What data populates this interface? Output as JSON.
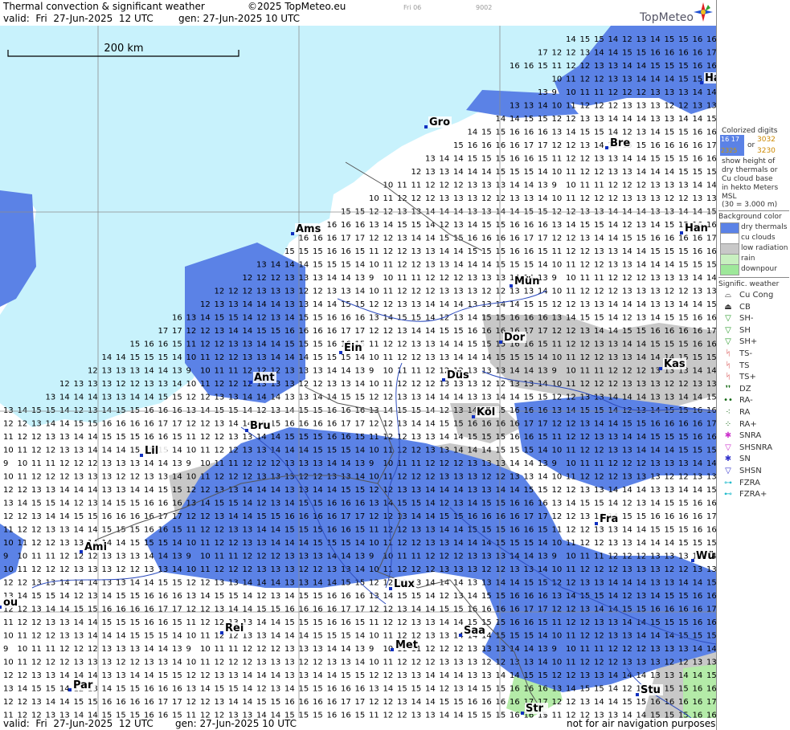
{
  "header": {
    "title": "Thermal convection & significant weather",
    "copyright": "©2025 TopMeteo.eu",
    "valid": "valid:  Fri  27-Jun-2025  12 UTC",
    "gen": "gen: 27-Jun-2025 10 UTC",
    "run_small": "Fri 06",
    "code_small": "9002",
    "brand": "TopMeteo"
  },
  "map": {
    "scale_label": "200 km",
    "colors": {
      "sea": "#c8f2fc",
      "dry": "#5b82e6",
      "cu": "#ffffff",
      "low": "#c8c8c8",
      "rain": "#b4eba8",
      "river": "#2c4bbd",
      "border": "#555555",
      "grid": "#8c8c8c"
    },
    "cities": [
      {
        "name": "Gro"
      },
      {
        "name": "Bre"
      },
      {
        "name": "Ha"
      },
      {
        "name": "Ams"
      },
      {
        "name": "Han"
      },
      {
        "name": "Mün"
      },
      {
        "name": "Dor"
      },
      {
        "name": "Ein"
      },
      {
        "name": "Ant"
      },
      {
        "name": "Düs"
      },
      {
        "name": "Kas"
      },
      {
        "name": "Bru"
      },
      {
        "name": "Köl"
      },
      {
        "name": "Lil"
      },
      {
        "name": "Fra"
      },
      {
        "name": "Ami"
      },
      {
        "name": "Wü"
      },
      {
        "name": "Lux"
      },
      {
        "name": "Rei"
      },
      {
        "name": "Saa"
      },
      {
        "name": "Met"
      },
      {
        "name": "Par"
      },
      {
        "name": "Stu"
      },
      {
        "name": "Str"
      },
      {
        "name": "ou"
      }
    ],
    "number_rows": [
      "13 14 15 15 14 12 13 14 15 15 16 16 16",
      "12 12 13 14 14 15 15 16 16 16 16 17 17",
      "11 12 12 13 13 14 14 15 15 15 16 16 15",
      "10 11 12 12 13 13 14 14 14 15 15 15 14",
      "9 10 11 11 12 12 12 13 13 13 14 14 13",
      "10 11 12 12 12 13 13 13 12 12 13 13 14",
      "12 12 13 13 14 14 14 13 13 14 14 15 15"
    ]
  },
  "footer": {
    "valid": "valid:  Fri  27-Jun-2025  12 UTC",
    "gen": "gen: 27-Jun-2025 10 UTC",
    "disclaimer": "not for air navigation purposes"
  },
  "legend": {
    "digits_title": [
      "Colorized digits"
    ],
    "digit_examples": {
      "a": "16 17",
      "b": "3032",
      "or": "or",
      "c": "2325",
      "d": "3230"
    },
    "digits_desc": [
      "show height of",
      "dry thermals or",
      "Cu cloud base",
      "in hekto Meters",
      "MSL",
      "(30 = 3.000 m)"
    ],
    "bg_title": "Background color",
    "bg_items": [
      {
        "label": "dry thermals",
        "color": "#5b82e6"
      },
      {
        "label": "cu clouds",
        "color": "#ffffff"
      },
      {
        "label": "low radiation",
        "color": "#c8c8c8"
      },
      {
        "label": "rain",
        "color": "#c8f0c0"
      },
      {
        "label": "downpour",
        "color": "#9ee89a"
      }
    ],
    "wx_title": "Signific. weather",
    "wx_items": [
      {
        "label": "Cu Cong",
        "icon": "cu-cong-icon",
        "glyph": "⌓",
        "color": "#333333"
      },
      {
        "label": "CB",
        "icon": "cb-icon",
        "glyph": "⏏",
        "color": "#333333"
      },
      {
        "label": "SH-",
        "icon": "shower-light-icon",
        "glyph": "▽",
        "color": "#2a9a2a"
      },
      {
        "label": "SH",
        "icon": "shower-icon",
        "glyph": "▽",
        "color": "#2a9a2a"
      },
      {
        "label": "SH+",
        "icon": "shower-heavy-icon",
        "glyph": "▽",
        "color": "#2a9a2a"
      },
      {
        "label": "TS-",
        "icon": "thunderstorm-light-icon",
        "glyph": "ᛋ",
        "color": "#cc2222"
      },
      {
        "label": "TS",
        "icon": "thunderstorm-icon",
        "glyph": "ᛋ",
        "color": "#cc2222"
      },
      {
        "label": "TS+",
        "icon": "thunderstorm-heavy-icon",
        "glyph": "ᛋ",
        "color": "#cc2222"
      },
      {
        "label": "DZ",
        "icon": "drizzle-icon",
        "glyph": "❜❜",
        "color": "#116611"
      },
      {
        "label": "RA-",
        "icon": "rain-light-icon",
        "glyph": "••",
        "color": "#116611"
      },
      {
        "label": "RA",
        "icon": "rain-icon",
        "glyph": "⁖",
        "color": "#116611"
      },
      {
        "label": "RA+",
        "icon": "rain-heavy-icon",
        "glyph": "⁘",
        "color": "#116611"
      },
      {
        "label": "SNRA",
        "icon": "snow-rain-icon",
        "glyph": "✱",
        "color": "#cc33cc"
      },
      {
        "label": "SHSNRA",
        "icon": "snow-rain-shower-icon",
        "glyph": "▽",
        "color": "#cc33cc"
      },
      {
        "label": "SN",
        "icon": "snow-icon",
        "glyph": "✱",
        "color": "#3333cc"
      },
      {
        "label": "SHSN",
        "icon": "snow-shower-icon",
        "glyph": "▽",
        "color": "#3333cc"
      },
      {
        "label": "FZRA",
        "icon": "freezing-rain-icon",
        "glyph": "⊶",
        "color": "#22bbcc"
      },
      {
        "label": "FZRA+",
        "icon": "freezing-rain-heavy-icon",
        "glyph": "⊷",
        "color": "#22bbcc"
      }
    ]
  }
}
